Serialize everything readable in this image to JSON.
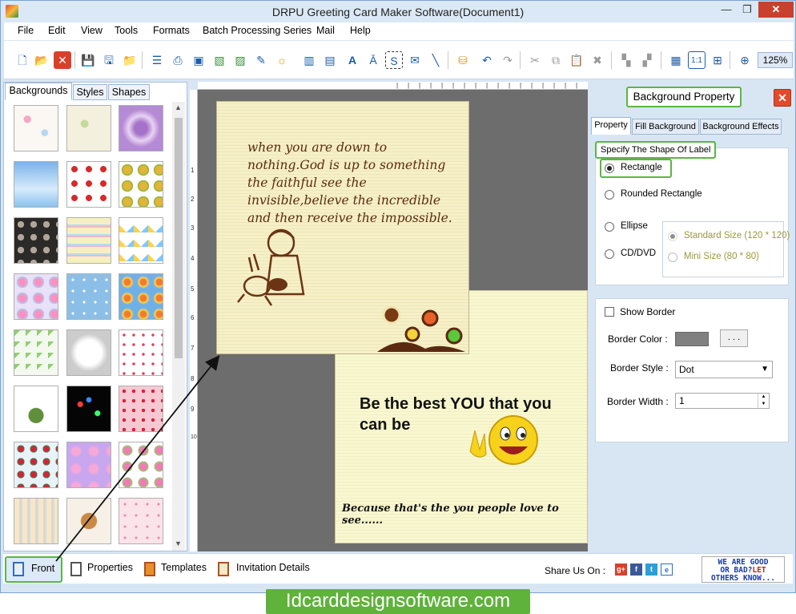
{
  "window": {
    "title": "DRPU Greeting Card Maker Software(Document1)",
    "minimize": "—",
    "maximize": "❐",
    "close": "✕"
  },
  "menu": [
    "File",
    "Edit",
    "View",
    "Tools",
    "Formats",
    "Batch Processing Series",
    "Mail",
    "Help"
  ],
  "toolbar": {
    "zoom": "125%",
    "icons": [
      "new-icon",
      "open-icon",
      "close-doc-icon",
      "save-icon",
      "save-as-icon",
      "open-folder-icon",
      "properties-icon",
      "print-icon",
      "print-preview-icon",
      "export-image-icon",
      "image-icon",
      "pen-icon",
      "picture-icon",
      "barcode-icon",
      "barcode2-icon",
      "text-icon",
      "wordart-icon",
      "signature-icon",
      "email-icon",
      "line-icon",
      "database-icon",
      "undo-icon",
      "redo-icon",
      "cut-icon",
      "copy-icon",
      "paste-icon",
      "delete-icon",
      "bring-front-icon",
      "send-back-icon",
      "grid-icon",
      "actual-size-icon",
      "fit-icon",
      "zoom-icon"
    ]
  },
  "left_panel": {
    "tabs": [
      "Backgrounds",
      "Styles",
      "Shapes"
    ],
    "active_tab": "Backgrounds"
  },
  "ruler": {
    "left_ticks": [
      "1",
      "2",
      "3",
      "4",
      "5",
      "6",
      "7",
      "8",
      "9",
      "10"
    ]
  },
  "card_front": {
    "quote": "when you are down to nothing.God is up to something the faithful see the invisible,believe the incredible and then receive the impossible."
  },
  "card_back": {
    "headline": "Be the best YOU that you can be",
    "footer": "Because that's the you people love to see......"
  },
  "right_panel": {
    "title": "Background Property",
    "close": "✕",
    "tabs": [
      "Property",
      "Fill Background",
      "Background Effects"
    ],
    "active_tab": "Property",
    "shape_group_label": "Specify The Shape Of Label",
    "shapes": {
      "rectangle": "Rectangle",
      "rounded_rectangle": "Rounded Rectangle",
      "ellipse": "Ellipse",
      "cd_dvd": "CD/DVD",
      "selected": "Rectangle"
    },
    "sizes": {
      "standard": "Standard Size (120 * 120)",
      "mini": "Mini Size (80 * 80)"
    },
    "border": {
      "show_border": "Show Border",
      "color_label": "Border Color :",
      "color_value": "#808080",
      "browse": ". . .",
      "style_label": "Border Style :",
      "style_value": "Dot",
      "width_label": "Border Width :",
      "width_value": "1"
    }
  },
  "bottom_bar": {
    "front": "Front",
    "properties": "Properties",
    "templates": "Templates",
    "invitation": "Invitation Details",
    "share": "Share Us On :",
    "social": [
      "g+",
      "f",
      "t",
      "e"
    ],
    "ad_line1": "WE ARE GOOD",
    "ad_line2a": "OR BAD?",
    "ad_line2b": "LET",
    "ad_line3": "OTHERS KNOW..."
  },
  "website": "Idcarddesignsoftware.com",
  "colors": {
    "accent_green": "#5bb643",
    "window_bg": "#d8e6f4",
    "canvas_bg": "#6d6d6d"
  }
}
